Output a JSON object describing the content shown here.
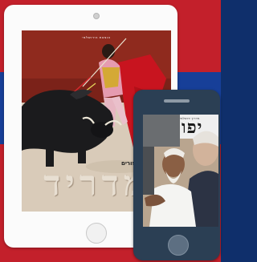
{
  "tablet": {
    "cover": {
      "publisher": "הוצאת הירושלמי",
      "subtitle": "סיפורים",
      "title": "מדריד"
    }
  },
  "phone": {
    "cover": {
      "masthead": "מדריך ירושלמי",
      "title": "יפו"
    }
  },
  "colors": {
    "background_red": "#c3202b",
    "background_blue": "#173f98",
    "tablet_body": "#fbfbfb",
    "phone_body": "#2b3f54"
  }
}
